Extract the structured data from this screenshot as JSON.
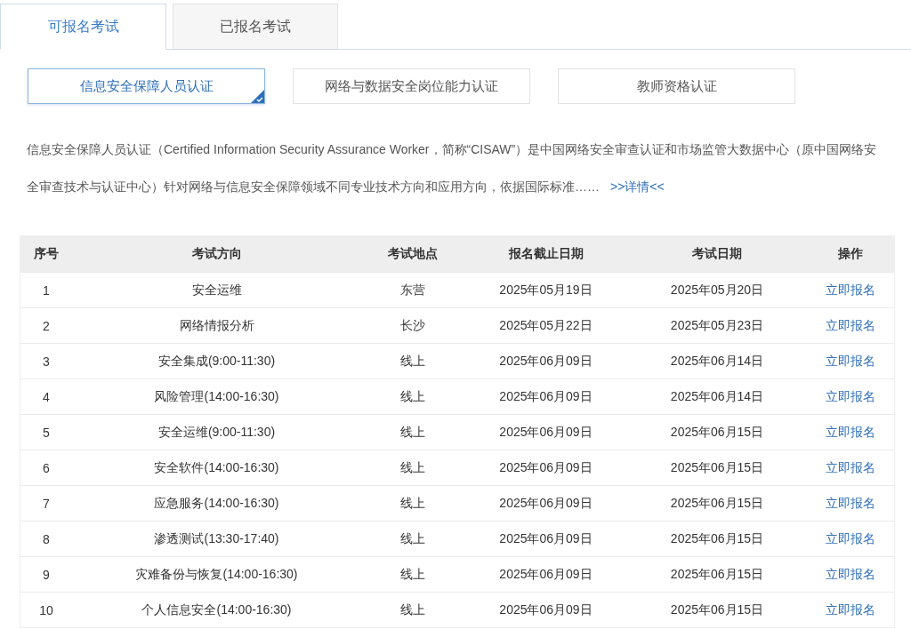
{
  "tabs": [
    {
      "label": "可报名考试",
      "selected": true
    },
    {
      "label": "已报名考试",
      "selected": false
    }
  ],
  "categories": [
    {
      "label": "信息安全保障人员认证",
      "selected": true
    },
    {
      "label": "网络与数据安全岗位能力认证",
      "selected": false
    },
    {
      "label": "教师资格认证",
      "selected": false
    }
  ],
  "description": {
    "text": "信息安全保障人员认证（Certified Information Security Assurance Worker，简称“CISAW”）是中国网络安全审查认证和市场监管大数据中心（原中国网络安全审查技术与认证中心）针对网络与信息安全保障领域不同专业技术方向和应用方向，依据国际标准……",
    "link": ">>详情<<"
  },
  "table": {
    "columns": [
      "序号",
      "考试方向",
      "考试地点",
      "报名截止日期",
      "考试日期",
      "操作"
    ],
    "rows": [
      [
        "1",
        "安全运维",
        "东营",
        "2025年05月19日",
        "2025年05月20日",
        "立即报名"
      ],
      [
        "2",
        "网络情报分析",
        "长沙",
        "2025年05月22日",
        "2025年05月23日",
        "立即报名"
      ],
      [
        "3",
        "安全集成(9:00-11:30)",
        "线上",
        "2025年06月09日",
        "2025年06月14日",
        "立即报名"
      ],
      [
        "4",
        "风险管理(14:00-16:30)",
        "线上",
        "2025年06月09日",
        "2025年06月14日",
        "立即报名"
      ],
      [
        "5",
        "安全运维(9:00-11:30)",
        "线上",
        "2025年06月09日",
        "2025年06月15日",
        "立即报名"
      ],
      [
        "6",
        "安全软件(14:00-16:30)",
        "线上",
        "2025年06月09日",
        "2025年06月15日",
        "立即报名"
      ],
      [
        "7",
        "应急服务(14:00-16:30)",
        "线上",
        "2025年06月09日",
        "2025年06月15日",
        "立即报名"
      ],
      [
        "8",
        "渗透测试(13:30-17:40)",
        "线上",
        "2025年06月09日",
        "2025年06月15日",
        "立即报名"
      ],
      [
        "9",
        "灾难备份与恢复(14:00-16:30)",
        "线上",
        "2025年06月09日",
        "2025年06月15日",
        "立即报名"
      ],
      [
        "10",
        "个人信息安全(14:00-16:30)",
        "线上",
        "2025年06月09日",
        "2025年06月15日",
        "立即报名"
      ]
    ]
  }
}
